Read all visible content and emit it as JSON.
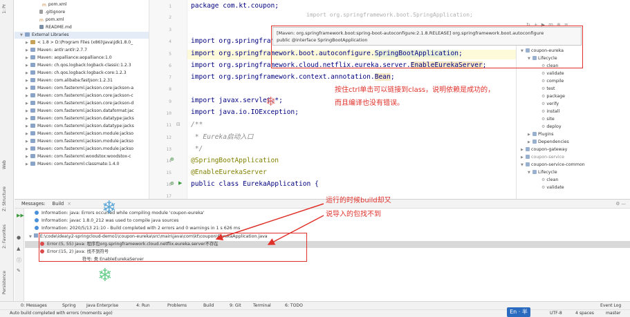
{
  "left_strip": {
    "items": [
      "1: Pr",
      "Web",
      "Z: Structure",
      "2: Favorites",
      "Persistence"
    ]
  },
  "project_tree": {
    "items": [
      {
        "label": "pom.xml",
        "icon": "xml-file-icon"
      },
      {
        "label": ".gitignore",
        "icon": "git-file-icon"
      },
      {
        "label": "pom.xml",
        "icon": "xml-file-icon"
      },
      {
        "label": "README.md",
        "icon": "markdown-file-icon"
      },
      {
        "label": "External Libraries",
        "icon": "libraries-icon"
      },
      {
        "label": "< 1.8 >  D:\\Program Files (x86)\\Java\\jdk1.8.0_",
        "icon": "jdk-icon"
      },
      {
        "label": "Maven: antlr:antlr:2.7.7",
        "icon": "library-icon"
      },
      {
        "label": "Maven: aopalliance:aopalliance:1.0",
        "icon": "library-icon"
      },
      {
        "label": "Maven: ch.qos.logback:logback-classic:1.2.3",
        "icon": "library-icon"
      },
      {
        "label": "Maven: ch.qos.logback:logback-core:1.2.3",
        "icon": "library-icon"
      },
      {
        "label": "Maven: com.alibaba:fastjson:1.2.31",
        "icon": "library-icon"
      },
      {
        "label": "Maven: com.fasterxml.jackson.core:jackson-a",
        "icon": "library-icon"
      },
      {
        "label": "Maven: com.fasterxml.jackson.core:jackson-c",
        "icon": "library-icon"
      },
      {
        "label": "Maven: com.fasterxml.jackson.core:jackson-d",
        "icon": "library-icon"
      },
      {
        "label": "Maven: com.fasterxml.jackson.dataformat:jac",
        "icon": "library-icon"
      },
      {
        "label": "Maven: com.fasterxml.jackson.datatype:jacks",
        "icon": "library-icon"
      },
      {
        "label": "Maven: com.fasterxml.jackson.datatype:jacks",
        "icon": "library-icon"
      },
      {
        "label": "Maven: com.fasterxml.jackson.module:jackso",
        "icon": "library-icon"
      },
      {
        "label": "Maven: com.fasterxml.jackson.module:jackso",
        "icon": "library-icon"
      },
      {
        "label": "Maven: com.fasterxml.jackson.module:jackso",
        "icon": "library-icon"
      },
      {
        "label": "Maven: com.fasterxml.woodstox:woodstox-c",
        "icon": "library-icon"
      },
      {
        "label": "Maven: com.fasterxml:classmate:1.4.0",
        "icon": "library-icon"
      }
    ]
  },
  "editor": {
    "line_numbers": [
      "1",
      "2",
      "3",
      "4",
      "5",
      "6",
      "7",
      "8",
      "9",
      "10",
      "11",
      "12",
      "13",
      "14",
      "15",
      "16",
      "17"
    ],
    "code": {
      "l1_kw": "package",
      "l1_rest": " com.kt.coupon;",
      "l1_ghost": "import org.springframework.boot.SpringApplication;",
      "l3_kw": "import",
      "l3_rest": " org.springframew",
      "l4_kw": "import",
      "l4_a": " org.springframework.boot.autoconfigure.",
      "l4_hl": "SpringBootApplication",
      "l4_b": ";",
      "l5_kw": "import",
      "l5_a": " org.springframework.cloud.netflix.eureka.server.",
      "l5_hl": "EnableEurekaServer",
      "l5_b": ";",
      "l6_kw": "import",
      "l6_a": " org.springframework.context.annotation.",
      "l6_hl": "Bean",
      "l6_b": ";",
      "l8_kw": "import",
      "l8_rest": " javax.servlet.*;",
      "l9_kw": "import",
      "l9_rest": " java.io.IOException;",
      "l11": "/**",
      "l12": " * Eureka启动入口",
      "l13": " */",
      "l14": "@SpringBootApplication",
      "l15": "@EnableEurekaServer",
      "l16_kw": "public class",
      "l16_rest": " EurekaApplication {"
    },
    "popup_line1": "[Maven: org.springframework.boot:spring-boot-autoconfigure:2.1.8.RELEASE] org.springframework.boot.autoconfigure",
    "popup_line2": "public @interface SpringBootApplication"
  },
  "annotations": {
    "note1_line1": "按住ctrl单击可以链接到class，说明依赖是成功的，",
    "note1_line2": "而且编译也没有错误。",
    "note2_line1": "运行的时候build却又",
    "note2_line2": "说导入的包找不到"
  },
  "maven_panel": {
    "items": [
      {
        "label": "coupon-eureka",
        "kind": "project"
      },
      {
        "label": "Lifecycle",
        "kind": "folder"
      },
      {
        "label": "clean",
        "kind": "goal"
      },
      {
        "label": "validate",
        "kind": "goal"
      },
      {
        "label": "compile",
        "kind": "goal"
      },
      {
        "label": "test",
        "kind": "goal"
      },
      {
        "label": "package",
        "kind": "goal"
      },
      {
        "label": "verify",
        "kind": "goal"
      },
      {
        "label": "install",
        "kind": "goal"
      },
      {
        "label": "site",
        "kind": "goal"
      },
      {
        "label": "deploy",
        "kind": "goal"
      },
      {
        "label": "Plugins",
        "kind": "folder"
      },
      {
        "label": "Dependencies",
        "kind": "folder"
      },
      {
        "label": "coupon-gateway",
        "kind": "project"
      },
      {
        "label": "coupon-service",
        "kind": "project"
      },
      {
        "label": "coupon-service-common",
        "kind": "project"
      },
      {
        "label": "Lifecycle",
        "kind": "folder"
      },
      {
        "label": "clean",
        "kind": "goal"
      },
      {
        "label": "validate",
        "kind": "goal"
      }
    ]
  },
  "messages": {
    "header_title": "Messages:",
    "tab_label": "Build",
    "lines": [
      {
        "type": "info",
        "text": "Information: java: Errors occurred while compiling module 'coupon-eureka'"
      },
      {
        "type": "info",
        "text": "Information: javac 1.8.0_212 was used to compile java sources"
      },
      {
        "type": "info",
        "text": "Information: 2020/5/13 21:10 - Build completed with 2 errors and 0 warnings in 1 s 626 ms"
      },
      {
        "type": "file",
        "text": "E:\\code\\idea\\y2-springcloud-demo1\\coupon-eureka\\src\\main\\java\\com\\kt\\coupon\\EurekaApplication.java"
      },
      {
        "type": "error",
        "text": "Error:(5, 55)  java: 程序包org.springframework.cloud.netflix.eureka.server不存在"
      },
      {
        "type": "error",
        "text": "Error:(15, 2)  java: 找不到符号"
      },
      {
        "type": "detail",
        "text": "符号: 类 EnableEurekaServer"
      }
    ]
  },
  "bottom_toolbar": {
    "items": [
      "0: Messages",
      "Spring",
      "Java Enterprise",
      "4: Run",
      "Problems",
      "Build",
      "9: Git",
      "Terminal",
      "6: TODO"
    ],
    "event_log": "Event Log"
  },
  "status_bar": {
    "message": "Auto build completed with errors (moments ago)",
    "ime": "En  ·  半",
    "encoding": "UTF-8",
    "indent": "4 spaces",
    "branch": "master"
  },
  "colors": {
    "annotation_red": "#e0302a",
    "error_red": "#db4b4b",
    "info_blue": "#4a90d9"
  }
}
